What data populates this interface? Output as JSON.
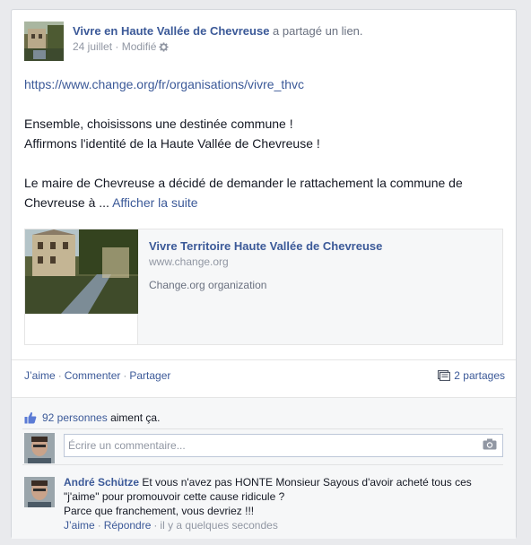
{
  "post": {
    "author": "Vivre en Haute Vallée de Chevreuse",
    "shared_text": " a partagé un lien.",
    "date": "24 juillet",
    "meta_sep": " · ",
    "modified": "Modifié",
    "url": "https://www.change.org/fr/organisations/vivre_thvc",
    "line1": "Ensemble, choisissons une destinée commune !",
    "line2": "Affirmons l'identité de la Haute Vallée de Chevreuse !",
    "line3": "Le maire de Chevreuse a décidé de demander le rattachement la commune de Chevreuse à ... ",
    "see_more": "Afficher la suite"
  },
  "attachment": {
    "title": "Vivre Territoire Haute Vallée de Chevreuse",
    "domain": "www.change.org",
    "description": "Change.org organization"
  },
  "actions": {
    "like": "J’aime",
    "comment": "Commenter",
    "share": "Partager",
    "sep": "·",
    "shares_count": "2 partages"
  },
  "likes": {
    "count_label": "92 personnes",
    "suffix": " aiment ça."
  },
  "composer": {
    "placeholder": "Écrire un commentaire..."
  },
  "comment": {
    "author": "André Schütze",
    "text1": " Et vous n'avez pas HONTE Monsieur Sayous d'avoir acheté tous ces \"j'aime\" pour promouvoir cette cause ridicule ?",
    "text2": "Parce que franchement, vous devriez !!!",
    "like": "J’aime",
    "reply": "Répondre",
    "sep": "·",
    "time": "il y a quelques secondes"
  },
  "icons": {
    "gear": "gear-icon",
    "share": "share-icon",
    "like": "thumbs-up-icon",
    "camera": "camera-icon"
  },
  "colors": {
    "link": "#3b5998",
    "muted": "#9197a3",
    "background": "#e9eaed"
  }
}
